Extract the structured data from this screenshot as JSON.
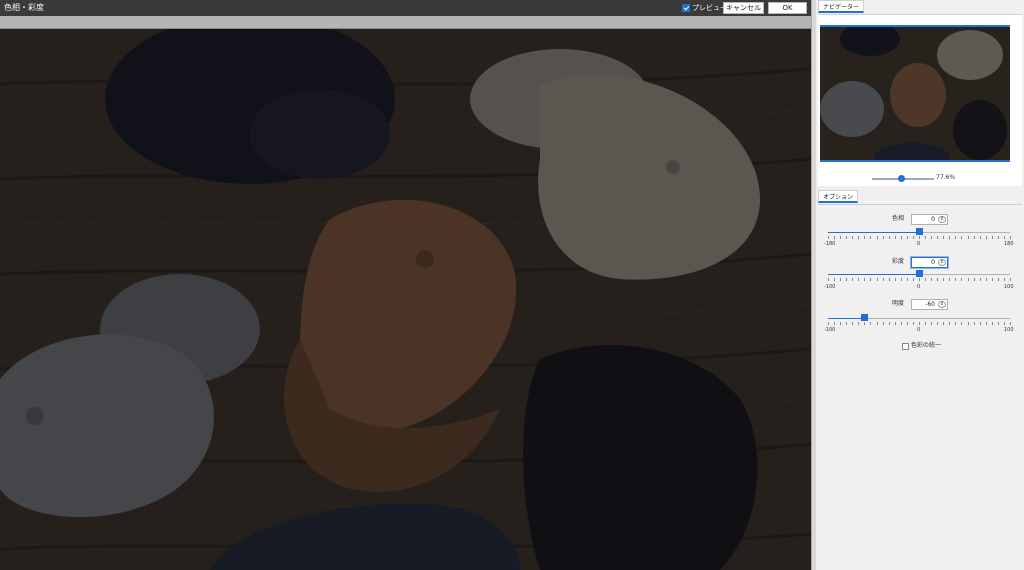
{
  "window": {
    "title": "色相・彩度"
  },
  "header": {
    "preview_label": "プレビュー",
    "preview_checked": true,
    "cancel_label": "キャンセル",
    "ok_label": "OK"
  },
  "navigator": {
    "tab_label": "ナビゲーター",
    "zoom": "77.6%"
  },
  "options": {
    "tab_label": "オプション",
    "hue": {
      "label": "色相",
      "value": "0",
      "min": "-180",
      "mid": "0",
      "max": "180",
      "level": 0.5
    },
    "saturation": {
      "label": "彩度",
      "value": "0",
      "min": "-100",
      "mid": "0",
      "max": "100",
      "level": 0.5
    },
    "lightness": {
      "label": "明度",
      "value": "-60",
      "min": "-100",
      "mid": "0",
      "max": "100",
      "level": 0.2
    },
    "unify_label": "色彩の統一",
    "unify_checked": false
  },
  "colors": {
    "accent": "#1e73d2",
    "titlebar": "#3a3a3a",
    "panel": "#f0f0f0"
  }
}
